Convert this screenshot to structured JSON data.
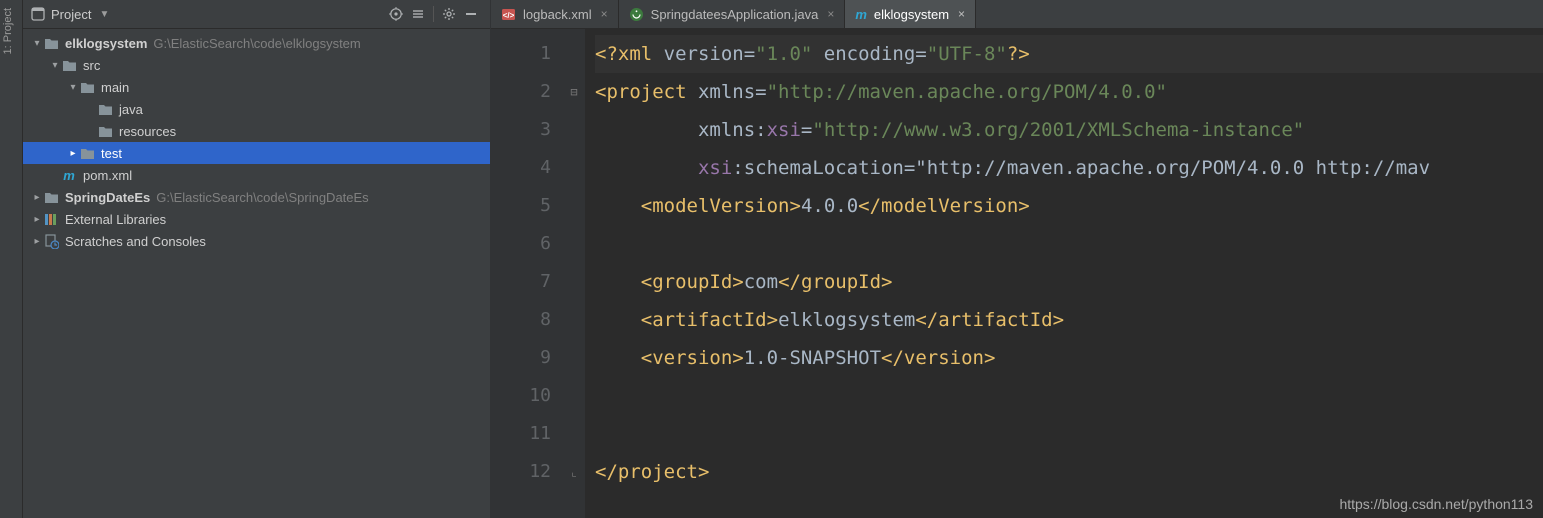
{
  "toolstrip": {
    "label": "1: Project"
  },
  "project_panel": {
    "title": "Project",
    "icons": {
      "target": "target-icon",
      "dirs": "select-opened-file-icon",
      "gear": "settings-icon",
      "hide": "hide-icon"
    }
  },
  "tree": {
    "rows": [
      {
        "depth": 0,
        "arrow": "down",
        "icon": "folder",
        "labelBold": true,
        "label": "elklogsystem",
        "path": "G:\\ElasticSearch\\code\\elklogsystem"
      },
      {
        "depth": 1,
        "arrow": "down",
        "icon": "folder",
        "label": "src"
      },
      {
        "depth": 2,
        "arrow": "down",
        "icon": "folder",
        "label": "main"
      },
      {
        "depth": 3,
        "arrow": "none",
        "icon": "folder",
        "label": "java"
      },
      {
        "depth": 3,
        "arrow": "none",
        "icon": "folder",
        "label": "resources"
      },
      {
        "depth": 2,
        "arrow": "right",
        "icon": "folder",
        "label": "test",
        "selected": true
      },
      {
        "depth": 1,
        "arrow": "none",
        "icon": "maven",
        "label": "pom.xml"
      },
      {
        "depth": 0,
        "arrow": "right",
        "icon": "folder",
        "labelBold": true,
        "label": "SpringDateEs",
        "path": "G:\\ElasticSearch\\code\\SpringDateEs"
      },
      {
        "depth": 0,
        "arrow": "right",
        "icon": "libs",
        "label": "External Libraries"
      },
      {
        "depth": 0,
        "arrow": "right",
        "icon": "scratch",
        "label": "Scratches and Consoles"
      }
    ]
  },
  "tabs": [
    {
      "icon": "xml",
      "label": "logback.xml",
      "active": false
    },
    {
      "icon": "java",
      "label": "SpringdateesApplication.java",
      "active": false
    },
    {
      "icon": "maven",
      "label": "elklogsystem",
      "active": true
    }
  ],
  "editor": {
    "line_count": 12,
    "fold_markers": {
      "2": "minus",
      "12": "end"
    },
    "lines": {
      "l1": "<?xml version=\"1.0\" encoding=\"UTF-8\"?>",
      "l2": "<project xmlns=\"http://maven.apache.org/POM/4.0.0\"",
      "l3": "         xmlns:xsi=\"http://www.w3.org/2001/XMLSchema-instance\"",
      "l4": "         xsi:schemaLocation=\"http://maven.apache.org/POM/4.0.0 http://mav",
      "l5": "    <modelVersion>4.0.0</modelVersion>",
      "l6": "",
      "l7": "    <groupId>com</groupId>",
      "l8": "    <artifactId>elklogsystem</artifactId>",
      "l9": "    <version>1.0-SNAPSHOT</version>",
      "l10": "",
      "l11": "",
      "l12": "</project>"
    }
  },
  "watermark": "https://blog.csdn.net/python113"
}
